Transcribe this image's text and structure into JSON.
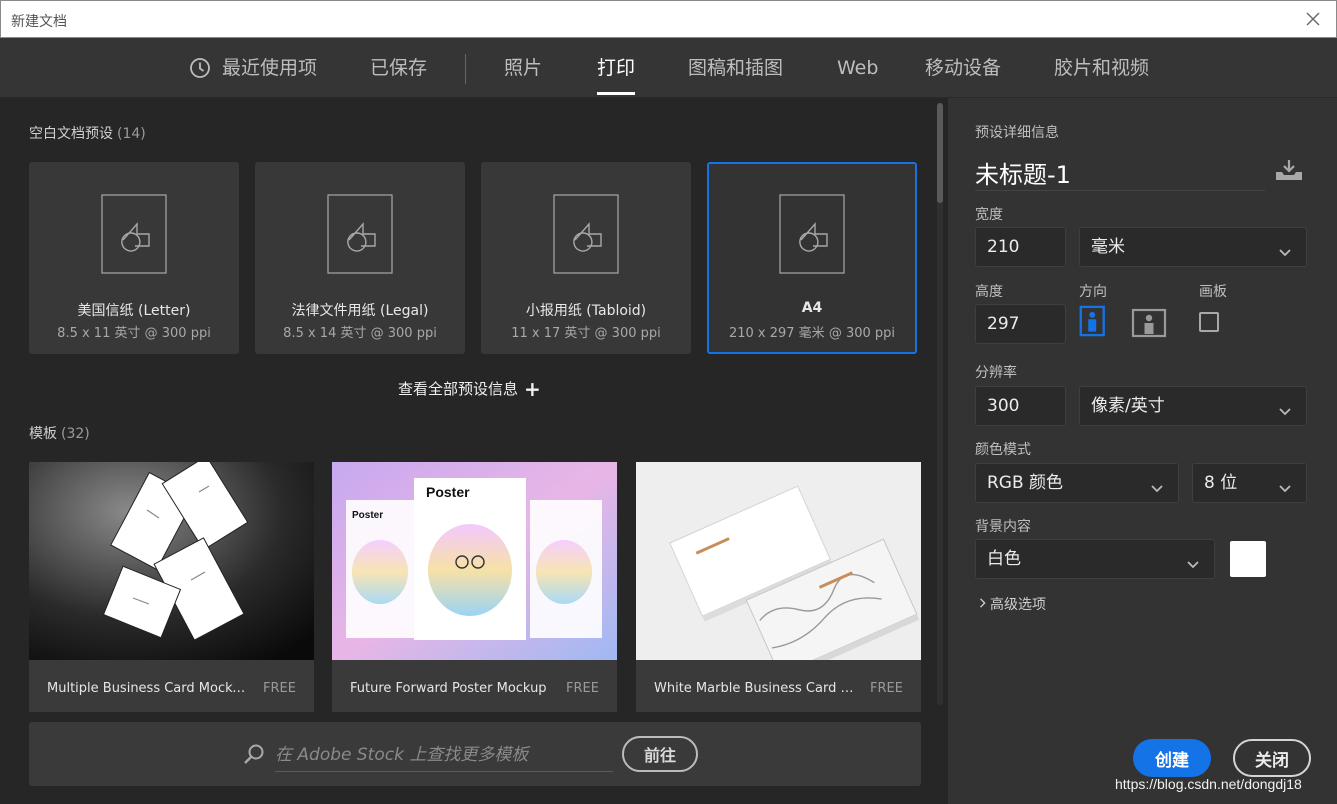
{
  "window": {
    "title": "新建文档"
  },
  "tabs": [
    {
      "label": "最近使用项",
      "icon": "clock-icon"
    },
    {
      "label": "已保存"
    },
    {
      "label": "照片"
    },
    {
      "label": "打印",
      "active": true
    },
    {
      "label": "图稿和插图"
    },
    {
      "label": "Web"
    },
    {
      "label": "移动设备"
    },
    {
      "label": "胶片和视频"
    }
  ],
  "blank_presets": {
    "title": "空白文档预设",
    "count": "(14)",
    "items": [
      {
        "name": "美国信纸 (Letter)",
        "size": "8.5 x 11 英寸 @ 300 ppi"
      },
      {
        "name": "法律文件用纸 (Legal)",
        "size": "8.5 x 14 英寸 @ 300 ppi"
      },
      {
        "name": "小报用纸 (Tabloid)",
        "size": "11 x 17 英寸 @ 300 ppi"
      },
      {
        "name": "A4",
        "size": "210 x 297 毫米 @ 300 ppi",
        "selected": true
      }
    ],
    "view_all": "查看全部预设信息"
  },
  "templates": {
    "title": "模板",
    "count": "(32)",
    "items": [
      {
        "name": "Multiple Business Card Mockups",
        "badge": "FREE"
      },
      {
        "name": "Future Forward Poster Mockup",
        "badge": "FREE",
        "poster_text": "Poster"
      },
      {
        "name": "White Marble Business Card Layout",
        "badge": "FREE"
      }
    ]
  },
  "stock_search": {
    "placeholder": "在 Adobe Stock 上查找更多模板",
    "go_label": "前往"
  },
  "details": {
    "header": "预设详细信息",
    "doc_title": "未标题-1",
    "width_label": "宽度",
    "width_value": "210",
    "width_unit": "毫米",
    "height_label": "高度",
    "height_value": "297",
    "orientation_label": "方向",
    "artboard_label": "画板",
    "resolution_label": "分辨率",
    "resolution_value": "300",
    "resolution_unit": "像素/英寸",
    "color_mode_label": "颜色模式",
    "color_mode": "RGB 颜色",
    "bit_depth": "8 位",
    "background_label": "背景内容",
    "background_value": "白色",
    "background_color": "#ffffff",
    "advanced_label": "高级选项"
  },
  "actions": {
    "create_label": "创建",
    "close_label": "关闭"
  },
  "watermark": "https://blog.csdn.net/dongdj18",
  "colors": {
    "accent": "#1473e6"
  }
}
